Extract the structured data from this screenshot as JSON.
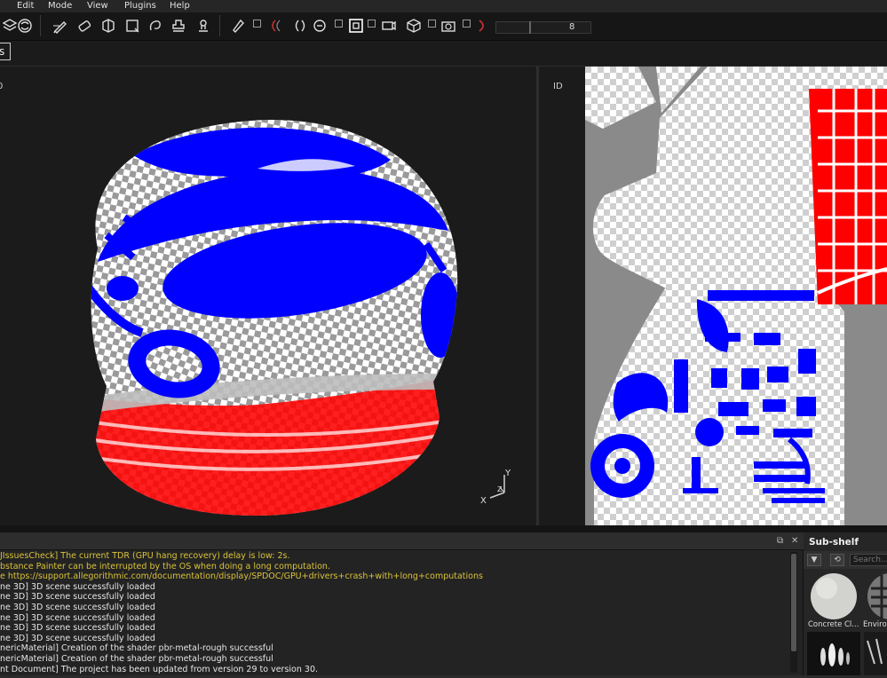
{
  "menubar": {
    "items": [
      "Edit",
      "Mode",
      "View",
      "Plugins",
      "Help"
    ]
  },
  "toolbar": {
    "icons": [
      "layers-icon",
      "symmetry-icon",
      "paint-brush-icon",
      "eraser-icon",
      "projection-icon",
      "polygon-fill-icon",
      "smudge-icon",
      "clone-stamp-icon",
      "material-picker-icon",
      "pen-icon",
      "brush-spacing-icon",
      "brush-hardness-icon",
      "bake-icon",
      "viewport-icon",
      "camera-icon",
      "cube-icon",
      "screenshot-icon",
      "lasso-icon"
    ],
    "slider_value": "8"
  },
  "row2": {
    "mode_badge": "s"
  },
  "viewport3d": {
    "corner_label": "0",
    "gizmo": {
      "x": "X",
      "y": "Y",
      "z": "Z"
    }
  },
  "viewport2d": {
    "label": "ID"
  },
  "colors": {
    "id_blue": "#0000ff",
    "id_red": "#ff0000",
    "warning": "#d9c23a"
  },
  "log": {
    "lines": [
      {
        "text": "JIssuesCheck] The current TDR (GPU hang recovery) delay is low: 2s.",
        "level": "warn"
      },
      {
        "text": "bstance Painter can be interrupted by the OS when doing a long computation.",
        "level": "warn"
      },
      {
        "text": "e https://support.allegorithmic.com/documentation/display/SPDOC/GPU+drivers+crash+with+long+computations",
        "level": "warn"
      },
      {
        "text": "ne 3D] 3D scene successfully loaded",
        "level": "info"
      },
      {
        "text": "ne 3D] 3D scene successfully loaded",
        "level": "info"
      },
      {
        "text": "ne 3D] 3D scene successfully loaded",
        "level": "info"
      },
      {
        "text": "ne 3D] 3D scene successfully loaded",
        "level": "info"
      },
      {
        "text": "ne 3D] 3D scene successfully loaded",
        "level": "info"
      },
      {
        "text": "ne 3D] 3D scene successfully loaded",
        "level": "info"
      },
      {
        "text": "nericMaterial] Creation of the shader pbr-metal-rough successful",
        "level": "info"
      },
      {
        "text": "nericMaterial] Creation of the shader pbr-metal-rough successful",
        "level": "info"
      },
      {
        "text": "nt Document] The project has been updated from version 29 to version 30.",
        "level": "info"
      }
    ]
  },
  "shelf": {
    "title": "Sub-shelf",
    "search_placeholder": "Search...",
    "items": [
      {
        "label": "Concrete Cl...",
        "icon": "concrete-material-icon"
      },
      {
        "label": "Environ",
        "icon": "environment-map-icon"
      },
      {
        "label": "",
        "icon": "brush-alpha-icon"
      },
      {
        "label": "",
        "icon": "brush-tip-icon"
      }
    ]
  }
}
